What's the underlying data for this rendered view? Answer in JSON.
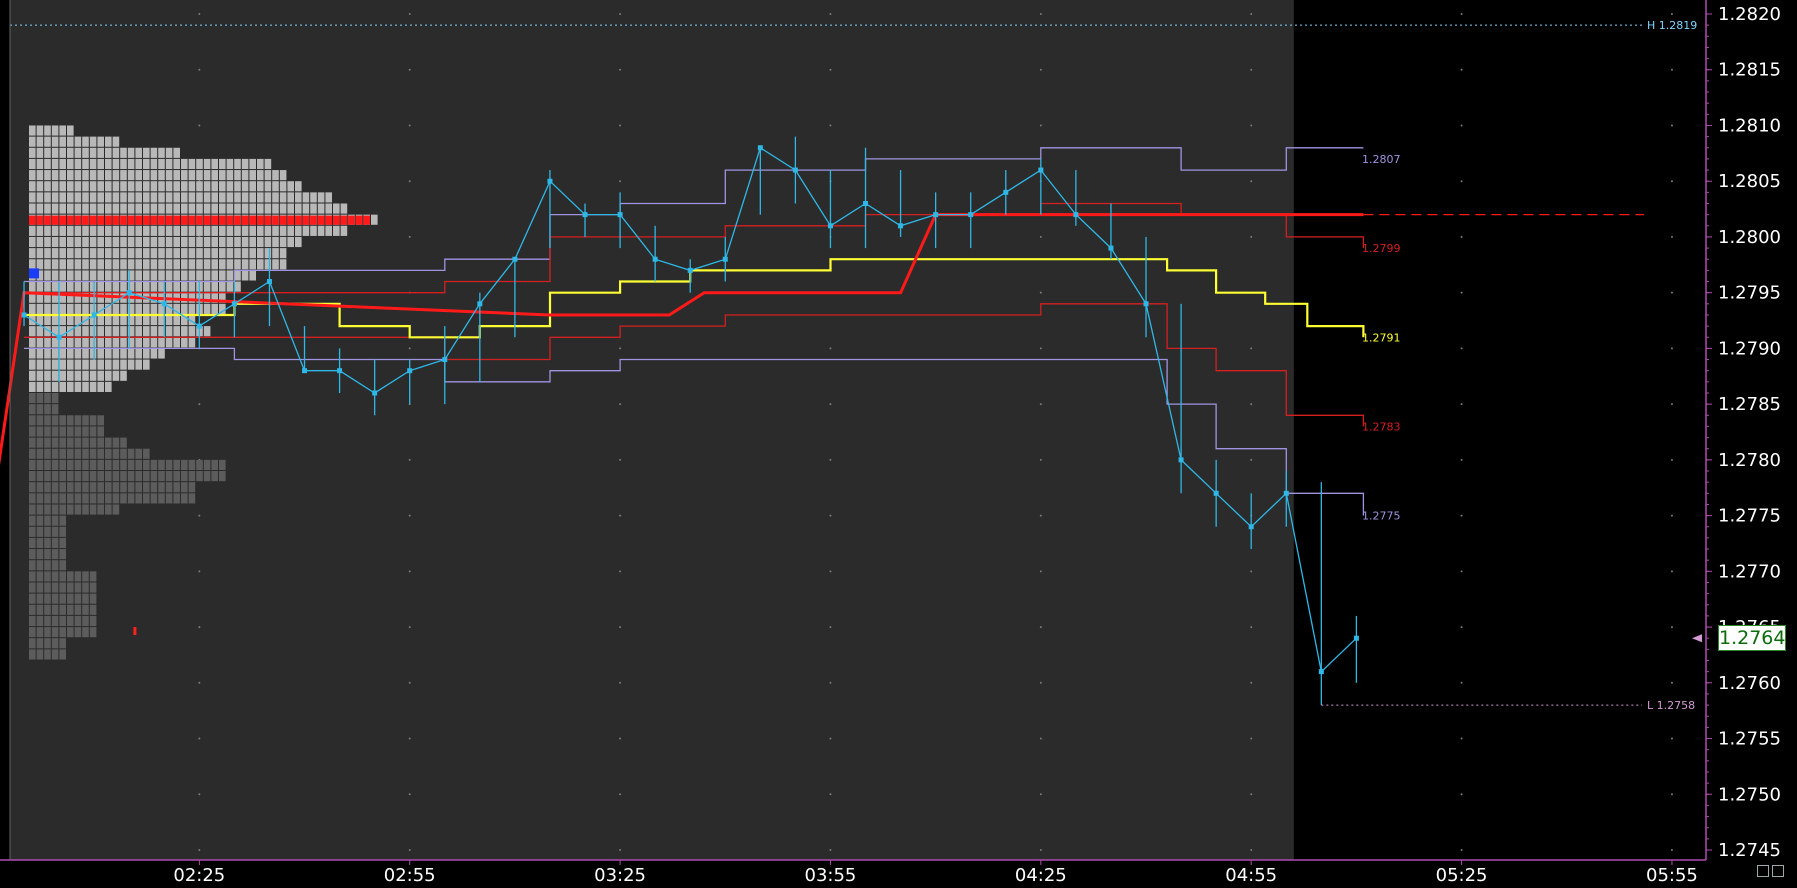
{
  "colors": {
    "plot_bg": "#2b2b2b",
    "future_bg": "#000000",
    "axis": "#b04cb0",
    "price_line": "#2fb7e6",
    "vwap": "#ffff33",
    "band1": "#d42020",
    "band2": "#9f94e0",
    "poc": "#ff1a1a",
    "profile_light": "#b8b8b8",
    "profile_dark": "#5c5c5c",
    "high_low_line": "#7fd4ff"
  },
  "top_info": "",
  "chart_data": {
    "type": "line",
    "ylim": [
      1.2745,
      1.282
    ],
    "y_ticks": [
      "1.2820",
      "1.2815",
      "1.2810",
      "1.2805",
      "1.2800",
      "1.2795",
      "1.2790",
      "1.2785",
      "1.2780",
      "1.2775",
      "1.2770",
      "1.2765",
      "1.2760",
      "1.2755",
      "1.2750",
      "1.2745"
    ],
    "x_ticks": [
      "02:25",
      "02:55",
      "03:25",
      "03:55",
      "04:25",
      "04:55",
      "05:25",
      "05:55"
    ],
    "x_tick_minutes": [
      145,
      175,
      205,
      235,
      265,
      295,
      325,
      355
    ],
    "x_start_minutes": 118,
    "data_end_minutes": 301,
    "x_end_minutes": 359,
    "price_series": [
      {
        "t": 120,
        "h": 1.2796,
        "l": 1.2792,
        "c": 1.2793
      },
      {
        "t": 125,
        "h": 1.2796,
        "l": 1.2787,
        "c": 1.2791
      },
      {
        "t": 130,
        "h": 1.2796,
        "l": 1.2789,
        "c": 1.2793
      },
      {
        "t": 135,
        "h": 1.2797,
        "l": 1.279,
        "c": 1.2795
      },
      {
        "t": 140,
        "h": 1.2796,
        "l": 1.2791,
        "c": 1.2794
      },
      {
        "t": 145,
        "h": 1.2796,
        "l": 1.279,
        "c": 1.2792
      },
      {
        "t": 150,
        "h": 1.2796,
        "l": 1.2791,
        "c": 1.2794
      },
      {
        "t": 155,
        "h": 1.2799,
        "l": 1.2792,
        "c": 1.2796
      },
      {
        "t": 160,
        "h": 1.2792,
        "l": 1.2788,
        "c": 1.2788
      },
      {
        "t": 165,
        "h": 1.279,
        "l": 1.2786,
        "c": 1.2788
      },
      {
        "t": 170,
        "h": 1.2789,
        "l": 1.2784,
        "c": 1.2786
      },
      {
        "t": 175,
        "h": 1.2789,
        "l": 1.2785,
        "c": 1.2788
      },
      {
        "t": 180,
        "h": 1.2792,
        "l": 1.2785,
        "c": 1.2789
      },
      {
        "t": 185,
        "h": 1.2795,
        "l": 1.2787,
        "c": 1.2794
      },
      {
        "t": 190,
        "h": 1.2798,
        "l": 1.2791,
        "c": 1.2798
      },
      {
        "t": 195,
        "h": 1.2806,
        "l": 1.2799,
        "c": 1.2805
      },
      {
        "t": 200,
        "h": 1.2803,
        "l": 1.28,
        "c": 1.2802
      },
      {
        "t": 205,
        "h": 1.2804,
        "l": 1.2799,
        "c": 1.2802
      },
      {
        "t": 210,
        "h": 1.2801,
        "l": 1.2796,
        "c": 1.2798
      },
      {
        "t": 215,
        "h": 1.2798,
        "l": 1.2795,
        "c": 1.2797
      },
      {
        "t": 220,
        "h": 1.28,
        "l": 1.2796,
        "c": 1.2798
      },
      {
        "t": 225,
        "h": 1.2808,
        "l": 1.2802,
        "c": 1.2808
      },
      {
        "t": 230,
        "h": 1.2809,
        "l": 1.2803,
        "c": 1.2806
      },
      {
        "t": 235,
        "h": 1.2806,
        "l": 1.2799,
        "c": 1.2801
      },
      {
        "t": 240,
        "h": 1.2808,
        "l": 1.2799,
        "c": 1.2803
      },
      {
        "t": 245,
        "h": 1.2806,
        "l": 1.28,
        "c": 1.2801
      },
      {
        "t": 250,
        "h": 1.2804,
        "l": 1.2799,
        "c": 1.2802
      },
      {
        "t": 255,
        "h": 1.2804,
        "l": 1.2799,
        "c": 1.2802
      },
      {
        "t": 260,
        "h": 1.2806,
        "l": 1.2802,
        "c": 1.2804
      },
      {
        "t": 265,
        "h": 1.2807,
        "l": 1.2802,
        "c": 1.2806
      },
      {
        "t": 270,
        "h": 1.2806,
        "l": 1.2801,
        "c": 1.2802
      },
      {
        "t": 275,
        "h": 1.2803,
        "l": 1.2798,
        "c": 1.2799
      },
      {
        "t": 280,
        "h": 1.28,
        "l": 1.2791,
        "c": 1.2794
      },
      {
        "t": 285,
        "h": 1.2794,
        "l": 1.2777,
        "c": 1.278
      },
      {
        "t": 290,
        "h": 1.278,
        "l": 1.2774,
        "c": 1.2777
      },
      {
        "t": 295,
        "h": 1.2777,
        "l": 1.2772,
        "c": 1.2774
      },
      {
        "t": 300,
        "h": 1.2779,
        "l": 1.2774,
        "c": 1.2777
      },
      {
        "t": 305,
        "h": 1.2778,
        "l": 1.2758,
        "c": 1.2761
      },
      {
        "t": 310,
        "h": 1.2766,
        "l": 1.276,
        "c": 1.2764
      }
    ],
    "vwap_series": [
      [
        120,
        1.2793
      ],
      [
        135,
        1.2793
      ],
      [
        150,
        1.2794
      ],
      [
        165,
        1.2792
      ],
      [
        175,
        1.2791
      ],
      [
        185,
        1.2792
      ],
      [
        195,
        1.2795
      ],
      [
        205,
        1.2796
      ],
      [
        215,
        1.2797
      ],
      [
        225,
        1.2797
      ],
      [
        235,
        1.2798
      ],
      [
        245,
        1.2798
      ],
      [
        255,
        1.2798
      ],
      [
        265,
        1.2798
      ],
      [
        275,
        1.2798
      ],
      [
        283,
        1.2797
      ],
      [
        290,
        1.2795
      ],
      [
        297,
        1.2794
      ],
      [
        303,
        1.2792
      ],
      [
        311,
        1.2791
      ]
    ],
    "band_series": [
      {
        "name": "upper2",
        "values": [
          [
            120,
            1.2796
          ],
          [
            150,
            1.2797
          ],
          [
            180,
            1.2798
          ],
          [
            195,
            1.2802
          ],
          [
            205,
            1.2803
          ],
          [
            220,
            1.2806
          ],
          [
            240,
            1.2807
          ],
          [
            265,
            1.2808
          ],
          [
            285,
            1.2806
          ],
          [
            300,
            1.2808
          ],
          [
            311,
            1.2808
          ]
        ]
      },
      {
        "name": "upper1",
        "values": [
          [
            120,
            1.2795
          ],
          [
            150,
            1.2795
          ],
          [
            180,
            1.2796
          ],
          [
            195,
            1.28
          ],
          [
            205,
            1.28
          ],
          [
            220,
            1.2801
          ],
          [
            240,
            1.2802
          ],
          [
            265,
            1.2803
          ],
          [
            285,
            1.2802
          ],
          [
            300,
            1.28
          ],
          [
            311,
            1.2799
          ]
        ]
      },
      {
        "name": "lower1",
        "values": [
          [
            120,
            1.2791
          ],
          [
            150,
            1.2791
          ],
          [
            180,
            1.2789
          ],
          [
            195,
            1.2791
          ],
          [
            205,
            1.2792
          ],
          [
            220,
            1.2793
          ],
          [
            240,
            1.2793
          ],
          [
            265,
            1.2794
          ],
          [
            283,
            1.279
          ],
          [
            290,
            1.2788
          ],
          [
            300,
            1.2784
          ],
          [
            311,
            1.2783
          ]
        ]
      },
      {
        "name": "lower2",
        "values": [
          [
            120,
            1.279
          ],
          [
            150,
            1.2789
          ],
          [
            180,
            1.2787
          ],
          [
            195,
            1.2788
          ],
          [
            205,
            1.2789
          ],
          [
            220,
            1.2789
          ],
          [
            240,
            1.2789
          ],
          [
            265,
            1.2789
          ],
          [
            283,
            1.2785
          ],
          [
            290,
            1.2781
          ],
          [
            300,
            1.2777
          ],
          [
            311,
            1.2775
          ]
        ]
      }
    ],
    "poc_line": [
      [
        116,
        1.2778
      ],
      [
        120,
        1.2795
      ],
      [
        195,
        1.2793
      ],
      [
        212,
        1.2793
      ],
      [
        217,
        1.2795
      ],
      [
        245,
        1.2795
      ],
      [
        250,
        1.2802
      ],
      [
        311,
        1.2802
      ]
    ],
    "band_labels": [
      {
        "text": "1.2807",
        "value": 1.2807,
        "color": "#9f94e0"
      },
      {
        "text": "1.2799",
        "value": 1.2799,
        "color": "#d42020"
      },
      {
        "text": "1.2791",
        "value": 1.2791,
        "color": "#ffff33"
      },
      {
        "text": "1.2783",
        "value": 1.2783,
        "color": "#d42020"
      },
      {
        "text": "1.2775",
        "value": 1.2775,
        "color": "#9f94e0"
      }
    ],
    "session_high": {
      "label": "H 1.2819",
      "value": 1.2819
    },
    "session_low": {
      "label": "L 1.2758",
      "value": 1.2758
    },
    "last_price": "1.2764",
    "market_profile": {
      "light_rows": [
        {
          "top": 1.281,
          "count": 6
        },
        {
          "top": 1.2809,
          "count": 12
        },
        {
          "top": 1.2808,
          "count": 20
        },
        {
          "top": 1.2807,
          "count": 32
        },
        {
          "top": 1.2806,
          "count": 34
        },
        {
          "top": 1.2805,
          "count": 36
        },
        {
          "top": 1.2804,
          "count": 40
        },
        {
          "top": 1.2803,
          "count": 42
        },
        {
          "top": 1.2802,
          "count": 46
        },
        {
          "top": 1.2801,
          "count": 42
        },
        {
          "top": 1.28,
          "count": 36
        },
        {
          "top": 1.2799,
          "count": 34
        },
        {
          "top": 1.2798,
          "count": 34
        },
        {
          "top": 1.2797,
          "count": 30
        },
        {
          "top": 1.2796,
          "count": 28
        },
        {
          "top": 1.2795,
          "count": 26
        },
        {
          "top": 1.2794,
          "count": 26
        },
        {
          "top": 1.2793,
          "count": 22
        },
        {
          "top": 1.2792,
          "count": 24
        },
        {
          "top": 1.2791,
          "count": 22
        },
        {
          "top": 1.279,
          "count": 18
        },
        {
          "top": 1.2789,
          "count": 16
        },
        {
          "top": 1.2788,
          "count": 13
        },
        {
          "top": 1.2787,
          "count": 11
        }
      ],
      "dark_rows": [
        {
          "top": 1.2786,
          "count": 4
        },
        {
          "top": 1.2785,
          "count": 4
        },
        {
          "top": 1.2784,
          "count": 10
        },
        {
          "top": 1.2783,
          "count": 10
        },
        {
          "top": 1.2782,
          "count": 13
        },
        {
          "top": 1.2781,
          "count": 16
        },
        {
          "top": 1.278,
          "count": 26
        },
        {
          "top": 1.2779,
          "count": 26
        },
        {
          "top": 1.2778,
          "count": 22
        },
        {
          "top": 1.2777,
          "count": 22
        },
        {
          "top": 1.2776,
          "count": 12
        },
        {
          "top": 1.2775,
          "count": 5
        },
        {
          "top": 1.2774,
          "count": 5
        },
        {
          "top": 1.2773,
          "count": 5
        },
        {
          "top": 1.2772,
          "count": 5
        },
        {
          "top": 1.2771,
          "count": 5
        },
        {
          "top": 1.277,
          "count": 9
        },
        {
          "top": 1.2769,
          "count": 9
        },
        {
          "top": 1.2768,
          "count": 9
        },
        {
          "top": 1.2767,
          "count": 9
        },
        {
          "top": 1.2766,
          "count": 9
        },
        {
          "top": 1.2765,
          "count": 9
        },
        {
          "top": 1.2764,
          "count": 5
        },
        {
          "top": 1.2763,
          "count": 5
        }
      ],
      "poc_value": 1.2802,
      "poc_count": 45
    }
  }
}
